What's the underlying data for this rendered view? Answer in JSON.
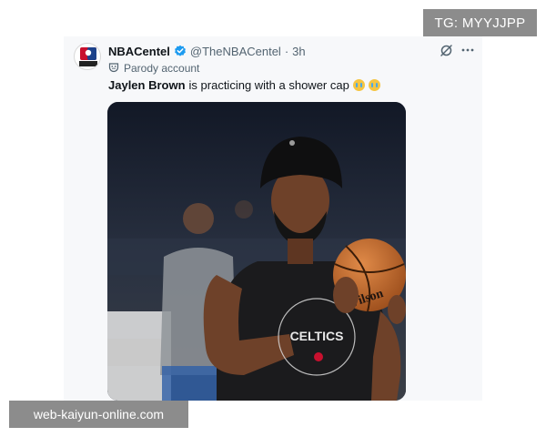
{
  "tweet": {
    "display_name": "NBACentel",
    "handle": "@TheNBACentel",
    "separator": "·",
    "time": "3h",
    "parody_label": "Parody account",
    "text_mention": "Jaylen Brown",
    "text_rest": "is practicing with a shower cap",
    "emojis": [
      "crying-face",
      "crying-face"
    ],
    "avatar_logo_text": "CENTEL",
    "image": {
      "description_icon": "photo",
      "jersey_text": "CELTICS",
      "ball_text": "Wilson"
    }
  },
  "icons": {
    "verified": "verified-badge-icon",
    "grok": "grok-icon",
    "more": "more-icon",
    "parody": "parody-mask-icon"
  },
  "colors": {
    "verified_blue": "#1d9bf0",
    "secondary_text": "#536471",
    "badge_bg": "#8c8c8c"
  },
  "watermarks": {
    "top_right": "TG: MYYJJPP",
    "bottom_left": "web-kaiyun-online.com"
  }
}
